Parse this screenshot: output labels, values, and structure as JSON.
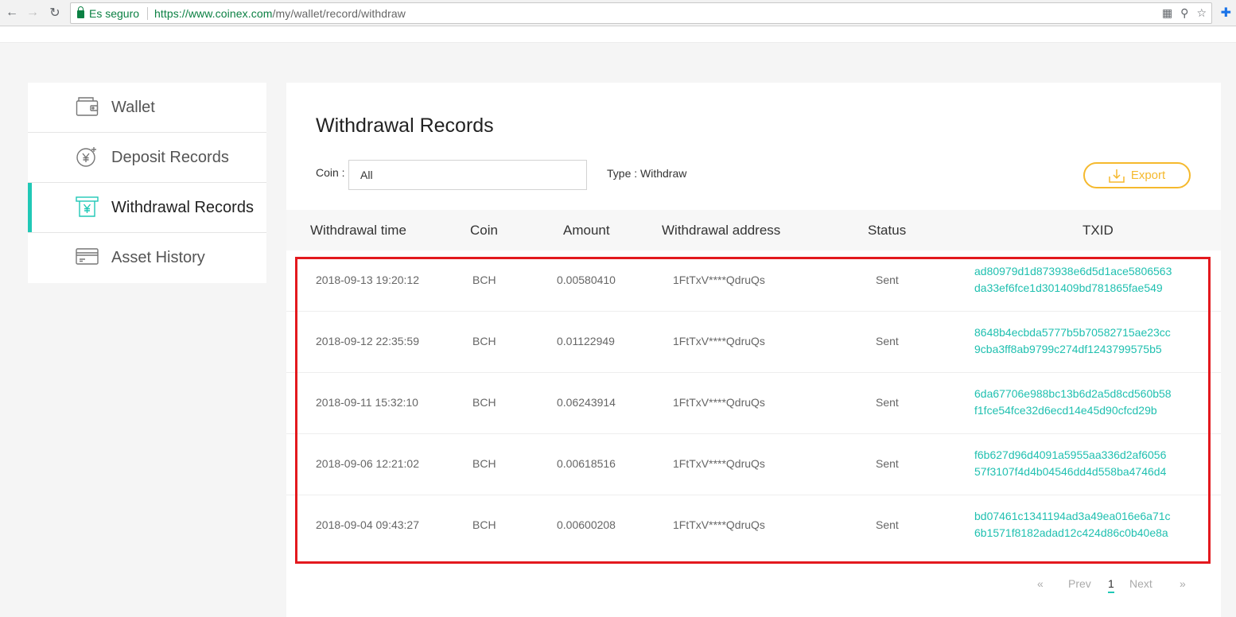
{
  "browser": {
    "secure_label": "Es seguro",
    "url_host": "https://www.coinex.com",
    "url_path": "/my/wallet/record/withdraw"
  },
  "sidebar": {
    "items": [
      {
        "label": "Wallet",
        "icon": "wallet-icon",
        "active": false
      },
      {
        "label": "Deposit Records",
        "icon": "deposit-icon",
        "active": false
      },
      {
        "label": "Withdrawal Records",
        "icon": "withdraw-icon",
        "active": true
      },
      {
        "label": "Asset History",
        "icon": "card-icon",
        "active": false
      }
    ]
  },
  "main": {
    "title": "Withdrawal Records",
    "coin_label": "Coin :",
    "coin_value": "All",
    "type_label": "Type : Withdraw",
    "export_label": "Export",
    "columns": [
      "Withdrawal time",
      "Coin",
      "Amount",
      "Withdrawal address",
      "Status",
      "TXID"
    ],
    "rows": [
      {
        "time": "2018-09-13 19:20:12",
        "coin": "BCH",
        "amount": "0.00580410",
        "address": "1FtTxV****QdruQs",
        "status": "Sent",
        "txid_1": "ad80979d1d873938e6d5d1ace5806563",
        "txid_2": "da33ef6fce1d301409bd781865fae549"
      },
      {
        "time": "2018-09-12 22:35:59",
        "coin": "BCH",
        "amount": "0.01122949",
        "address": "1FtTxV****QdruQs",
        "status": "Sent",
        "txid_1": "8648b4ecbda5777b5b70582715ae23cc",
        "txid_2": "9cba3ff8ab9799c274df1243799575b5"
      },
      {
        "time": "2018-09-11 15:32:10",
        "coin": "BCH",
        "amount": "0.06243914",
        "address": "1FtTxV****QdruQs",
        "status": "Sent",
        "txid_1": "6da67706e988bc13b6d2a5d8cd560b58",
        "txid_2": "f1fce54fce32d6ecd14e45d90cfcd29b"
      },
      {
        "time": "2018-09-06 12:21:02",
        "coin": "BCH",
        "amount": "0.00618516",
        "address": "1FtTxV****QdruQs",
        "status": "Sent",
        "txid_1": "f6b627d96d4091a5955aa336d2af6056",
        "txid_2": "57f3107f4d4b04546dd4d558ba4746d4"
      },
      {
        "time": "2018-09-04 09:43:27",
        "coin": "BCH",
        "amount": "0.00600208",
        "address": "1FtTxV****QdruQs",
        "status": "Sent",
        "txid_1": "bd07461c1341194ad3a49ea016e6a71c",
        "txid_2": "6b1571f8182adad12c424d86c0b40e8a"
      }
    ]
  },
  "pagination": {
    "first": "«",
    "prev": "Prev",
    "current": "1",
    "next": "Next",
    "last": "»"
  },
  "colors": {
    "accent": "#20c8b6",
    "export": "#f5b92d",
    "highlight": "#e3191e"
  }
}
